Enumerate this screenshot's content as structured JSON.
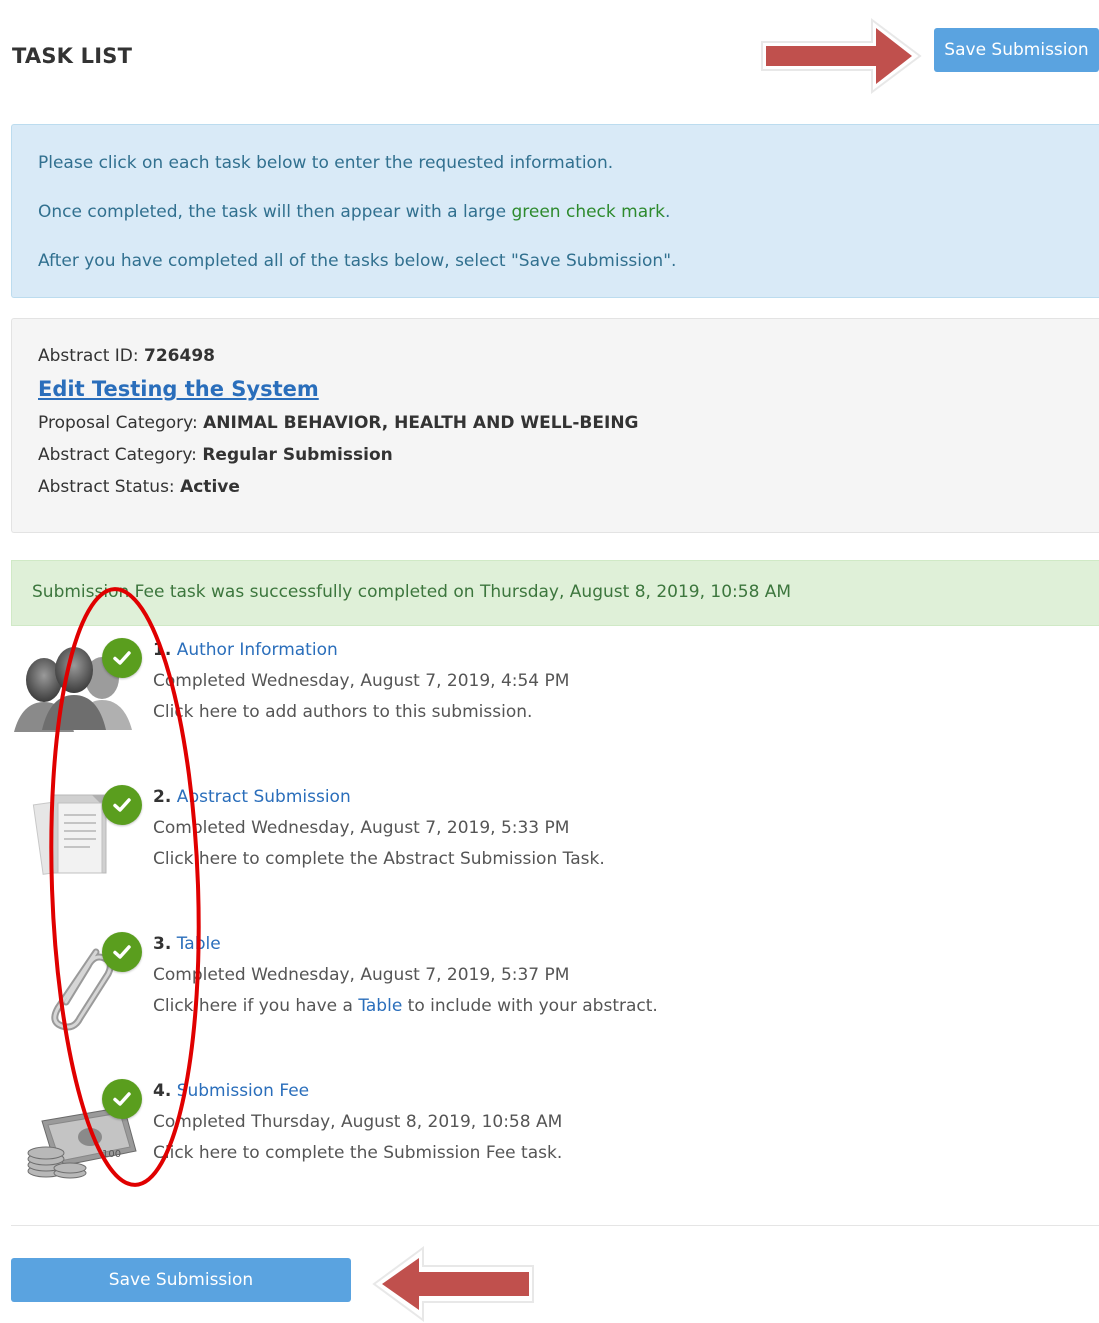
{
  "header": {
    "title": "TASK LIST",
    "save_label": "Save Submission"
  },
  "info": {
    "line1": "Please click on each task below to enter the requested information.",
    "line2_prefix": "Once completed, the task will then appear with a large ",
    "line2_highlight": "green check mark",
    "line2_suffix": ".",
    "line3": "After you have completed all of the tasks below, select \"Save Submission\".",
    "highlight_color": "#2d8a2d"
  },
  "abstract": {
    "id_label": "Abstract ID: ",
    "id_value": "726498",
    "edit_link": "Edit Testing the System",
    "proposal_label": "Proposal Category: ",
    "proposal_value": "ANIMAL BEHAVIOR, HEALTH AND WELL-BEING",
    "category_label": "Abstract Category: ",
    "category_value": "Regular Submission",
    "status_label": "Abstract Status: ",
    "status_value": "Active"
  },
  "success": {
    "message": "Submission Fee task was successfully completed on Thursday, August 8, 2019, 10:58 AM"
  },
  "tasks": [
    {
      "number": "1.",
      "title": "Author Information",
      "completed": "Completed Wednesday, August 7, 2019, 4:54 PM",
      "description": "Click here to add authors to this submission.",
      "icon": "authors-icon"
    },
    {
      "number": "2.",
      "title": "Abstract Submission",
      "completed": "Completed Wednesday, August 7, 2019, 5:33 PM",
      "description": "Click here to complete the Abstract Submission Task.",
      "icon": "documents-icon"
    },
    {
      "number": "3.",
      "title": "Table",
      "completed": "Completed Wednesday, August 7, 2019, 5:37 PM",
      "description_prefix": "Click here if you have a ",
      "description_link": "Table",
      "description_suffix": " to include with your abstract.",
      "icon": "paperclip-icon"
    },
    {
      "number": "4.",
      "title": "Submission Fee",
      "completed": "Completed Thursday, August 8, 2019, 10:58 AM",
      "description": "Click here to complete the Submission Fee task.",
      "icon": "money-icon"
    }
  ],
  "footer": {
    "save_label": "Save Submission"
  },
  "colors": {
    "primary_button": "#5aa3e0",
    "check_green": "#5a9e1e",
    "annotation_arrow": "#c0504d",
    "annotation_ellipse": "#e00000",
    "link": "#2a6ebb"
  }
}
